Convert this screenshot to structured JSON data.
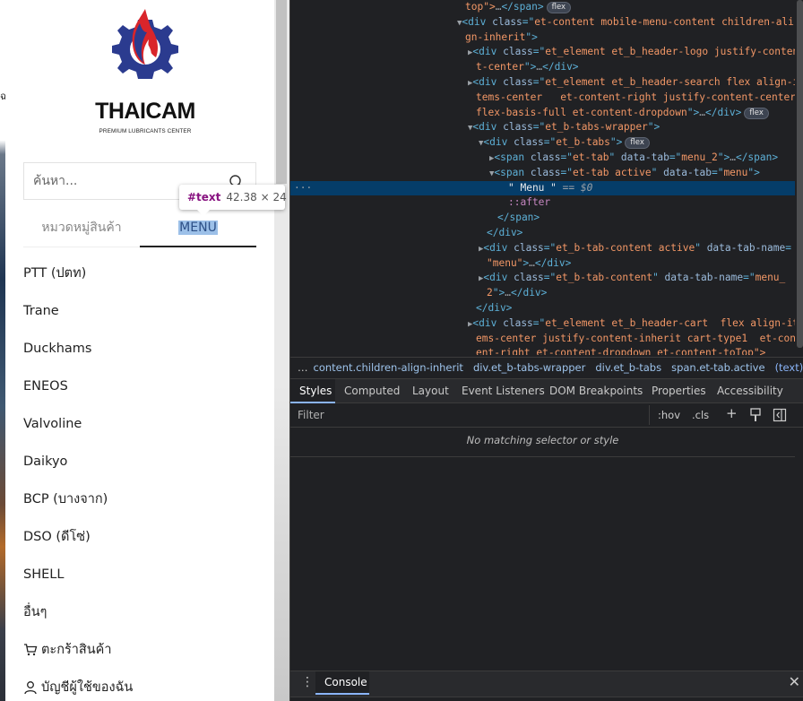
{
  "page": {
    "logo": {
      "name": "THAICAM",
      "tagline": "PREMIUM LUBRICANTS CENTER"
    },
    "search": {
      "placeholder": "ค้นหา..."
    },
    "tabs": [
      {
        "label": "หมวดหมู่สินค้า"
      },
      {
        "label": "MENU"
      }
    ],
    "menu_items": [
      {
        "label": "PTT (ปตท)"
      },
      {
        "label": "Trane"
      },
      {
        "label": "Duckhams"
      },
      {
        "label": "ENEOS"
      },
      {
        "label": "Valvoline"
      },
      {
        "label": "Daikyo"
      },
      {
        "label": "BCP (บางจาก)"
      },
      {
        "label": "DSO (ดีโซ่)"
      },
      {
        "label": "SHELL"
      },
      {
        "label": "อื่นๆ"
      },
      {
        "label": "ตะกร้าสินค้า",
        "icon": "cart-icon"
      },
      {
        "label": "บัญชีผู้ใช้ของฉัน",
        "icon": "user-icon"
      }
    ],
    "edge_text": "ฉ",
    "tooltip": {
      "node": "#text",
      "size": "42.38 × 24"
    }
  },
  "devtools": {
    "tree": {
      "l0": {
        "a": "top\">",
        "b": "…",
        "c": "</span>",
        "badge": "flex"
      },
      "l1": {
        "tag": "<div ",
        "an": "class",
        "eq": "=\"",
        "av": "et-content mobile-menu-content children-ali"
      },
      "l1b": {
        "av": "gn-inherit",
        "end": "\">"
      },
      "l2": {
        "tag": "<div ",
        "an": "class",
        "eq": "=\"",
        "av": "et_element et_b_header-logo justify-conten"
      },
      "l2b": {
        "av": "t-center",
        "end": "\">",
        "dots": "…",
        "close": "</div>"
      },
      "l3": {
        "tag": "<div ",
        "an": "class",
        "eq": "=\"",
        "av": "et_element et_b_header-search flex align-i"
      },
      "l3b": {
        "av": "tems-center   et-content-right justify-content-center"
      },
      "l3c": {
        "av": "flex-basis-full et-content-dropdown",
        "end": "\">",
        "dots": "…",
        "close": "</div>",
        "badge": "flex"
      },
      "l4": {
        "tag": "<div ",
        "an": "class",
        "eq": "=\"",
        "av": "et_b-tabs-wrapper",
        "end": "\">"
      },
      "l5": {
        "tag": "<div ",
        "an": "class",
        "eq": "=\"",
        "av": "et_b-tabs",
        "end": "\">",
        "badge": "flex"
      },
      "l6": {
        "tag": "<span ",
        "an": "class",
        "eq": "=\"",
        "av": "et-tab",
        "an2": " data-tab",
        "av2": "menu_2",
        "end": "\">",
        "dots": "…",
        "close": "</span>"
      },
      "l7": {
        "tag": "<span ",
        "an": "class",
        "eq": "=\"",
        "av": "et-tab active",
        "an2": " data-tab",
        "av2": "menu",
        "end": "\">"
      },
      "l8": {
        "tx": "\" Menu \"",
        "eq": " == ",
        "var": "$0",
        "dots": "···"
      },
      "l9": {
        "ps": "::after"
      },
      "l10": {
        "close": "</span>"
      },
      "l11": {
        "close": "</div>"
      },
      "l12": {
        "tag": "<div ",
        "an": "class",
        "eq": "=\"",
        "av": "et_b-tab-content active",
        "an2": " data-tab-name",
        "tail": "="
      },
      "l12b": {
        "av": "\"menu\"",
        "end": ">",
        "dots": "…",
        "close": "</div>"
      },
      "l13": {
        "tag": "<div ",
        "an": "class",
        "eq": "=\"",
        "av": "et_b-tab-content",
        "an2": " data-tab-name",
        "av2": "menu_"
      },
      "l13b": {
        "av": "2",
        "end": "\">",
        "dots": "…",
        "close": "</div>"
      },
      "l14": {
        "close": "</div>"
      },
      "l15": {
        "tag": "<div ",
        "an": "class",
        "eq": "=\"",
        "av": "et_element et_b_header-cart  flex align-it"
      },
      "l15b": {
        "av": "ems-center justify-content-inherit cart-type1  et-cont"
      },
      "l15c": {
        "av": "ent-right et-content-dropdown et-content-toTop\">"
      }
    },
    "breadcrumbs": [
      "…",
      "content.children-align-inherit",
      "div.et_b-tabs-wrapper",
      "div.et_b-tabs",
      "span.et-tab.active",
      "(text)",
      "…"
    ],
    "subtabs": [
      "Styles",
      "Computed",
      "Layout",
      "Event Listeners",
      "DOM Breakpoints",
      "Properties",
      "Accessibility"
    ],
    "filter": {
      "placeholder": "Filter",
      "hov": ":hov",
      "cls": ".cls",
      "plus": "+"
    },
    "styles_message": "No matching selector or style",
    "drawer": {
      "tab": "Console",
      "close": "✕"
    }
  }
}
